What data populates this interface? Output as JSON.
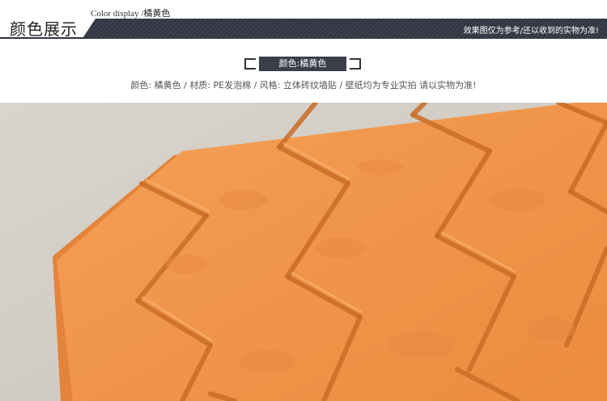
{
  "header": {
    "title_cn": "颜色展示",
    "title_en": "Color display",
    "title_en_sub": "/橘黄色",
    "note": "效果图仅为参考/还以收到的实物为准!"
  },
  "label": {
    "text": "颜色:橘黄色"
  },
  "description": "颜色: 橘黄色 / 材质: PE发泡棉 / 风格: 立体砖纹墙贴 / 壁纸均为专业实拍 请以实物为准!",
  "photo": {
    "colors": {
      "brick": "#f0954a",
      "brick_shadow": "#c86b25",
      "background_wall": "#d8d4cc"
    }
  }
}
